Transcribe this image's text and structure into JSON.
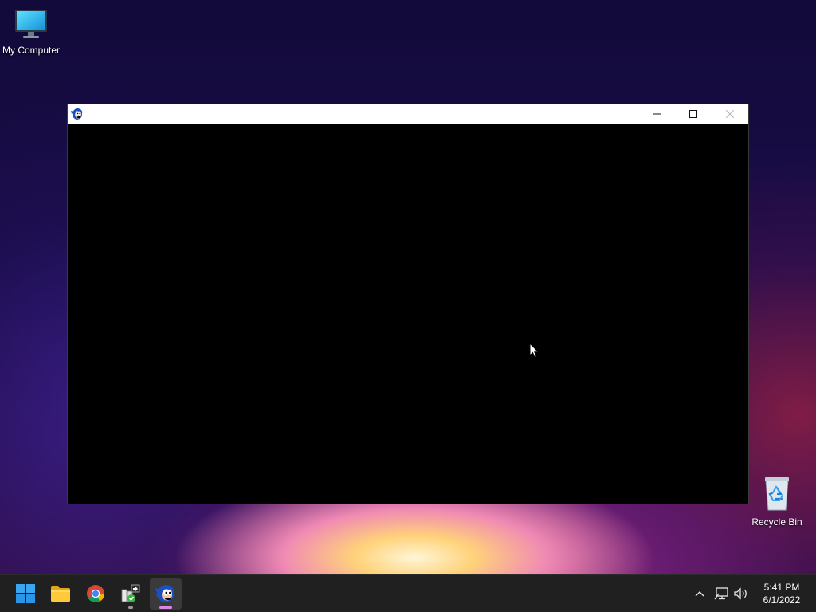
{
  "desktop": {
    "icons": [
      {
        "label": "My Computer",
        "icon": "monitor-icon"
      },
      {
        "label": "Recycle Bin",
        "icon": "recycle-bin-icon"
      }
    ]
  },
  "window": {
    "app_icon": "sonic-icon",
    "buttons": [
      "minimize",
      "maximize",
      "close"
    ]
  },
  "taskbar": {
    "apps": [
      {
        "name": "start",
        "icon": "windows-logo-icon"
      },
      {
        "name": "file-explorer",
        "icon": "folder-icon"
      },
      {
        "name": "chrome",
        "icon": "chrome-icon"
      },
      {
        "name": "app-installer",
        "icon": "installer-icon",
        "running": true
      },
      {
        "name": "sonic",
        "icon": "sonic-icon",
        "active": true
      }
    ],
    "tray": [
      "chevron-up-icon",
      "network-icon",
      "volume-icon"
    ],
    "clock": {
      "time": "5:41 PM",
      "date": "6/1/2022"
    }
  },
  "colors": {
    "taskbar_bg": "#202020",
    "window_client_bg": "#000000",
    "active_indicator": "#d987e6"
  }
}
